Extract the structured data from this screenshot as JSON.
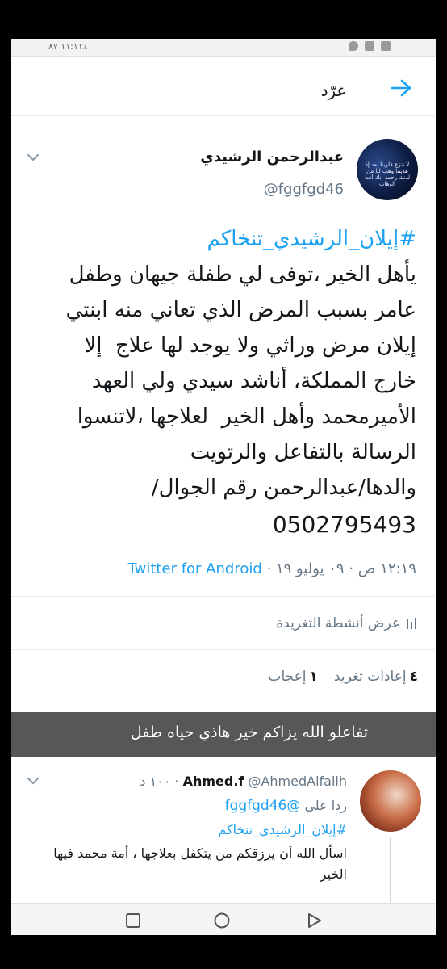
{
  "status_bar": {
    "time": "١١:١١",
    "battery": "٨٧٪"
  },
  "top_bar": {
    "title": "غرّد"
  },
  "tweet": {
    "author_name": "عبدالرحمن الرشيدي",
    "author_handle": "@fggfgd46",
    "avatar_text": "لا تنزع قلوبنا بعد إذ هديتنا وهب لنا من لدنك رحمة إنك أنت الوهاب",
    "hashtag": "#إيلان_الرشيدي_تنخاكم",
    "text": "يأهل الخير ،توفى لي طفلة جيهان وطفل عامر بسبب المرض الذي تعاني منه ابنتي إيلان مرض وراثي ولا يوجد لها علاج  إلا خارج المملكة، أناشد سيدي ولي العهد الأميرمحمد وأهل الخير  لعلاجها ،لاتنسوا الرسالة بالتفاعل والرتويت\nوالدها/عبدالرحمن رقم الجوال/",
    "phone": "0502795493",
    "timestamp": "١٢:١٩ ص · ٠٩ يوليو ١٩ · ",
    "source": "Twitter for Android",
    "activity_label": "عرض أنشطة التغريدة",
    "retweets_count": "٤",
    "retweets_label": "إعادات تغريد",
    "likes_count": "١",
    "likes_label": "إعجاب"
  },
  "toast": {
    "text": "تفاعلو الله يزاكم خير هاذي حياه طفل"
  },
  "reply": {
    "name": "Ahmed.f",
    "handle": "@AhmedAlfalih",
    "time": "· ١٠٠ د",
    "replying_to_label": "ردا على",
    "replying_to_handle": "@fggfgd46",
    "hashtag": "#إيلان_الرشيدي_تنخاكم",
    "text": "اسأل الله أن يرزقكم من يتكفل بعلاجها ، أمة محمد فيها الخير"
  },
  "colors": {
    "accent": "#1da1f2",
    "text": "#14171a",
    "muted": "#657786"
  }
}
